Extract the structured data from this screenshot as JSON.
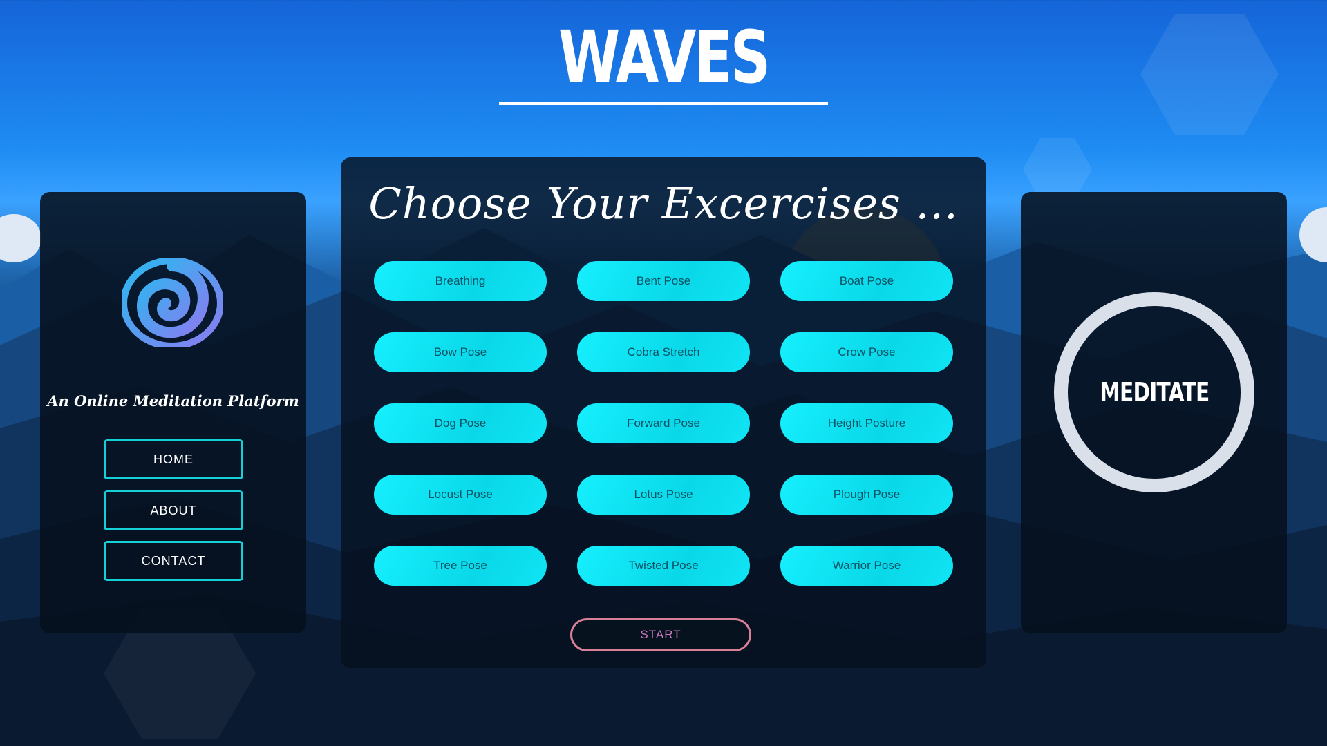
{
  "brand": {
    "title": "WAVES",
    "tagline": "An Online Meditation Platform"
  },
  "nav": {
    "home": "HOME",
    "about": "ABOUT",
    "contact": "CONTACT"
  },
  "exercises": {
    "heading": "Choose Your Excercises ...",
    "poses": [
      "Breathing",
      "Bent Pose",
      "Boat Pose",
      "Bow Pose",
      "Cobra Stretch",
      "Crow Pose",
      "Dog Pose",
      "Forward Pose",
      "Height Posture",
      "Locust Pose",
      "Lotus Pose",
      "Plough Pose",
      "Tree Pose",
      "Twisted Pose",
      "Warrior Pose"
    ],
    "start_label": "START"
  },
  "meditate": {
    "label": "MEDITATE"
  },
  "colors": {
    "accent": "#16d0d8",
    "pose_button": "#10e4f4",
    "start_border": "#d88098"
  }
}
